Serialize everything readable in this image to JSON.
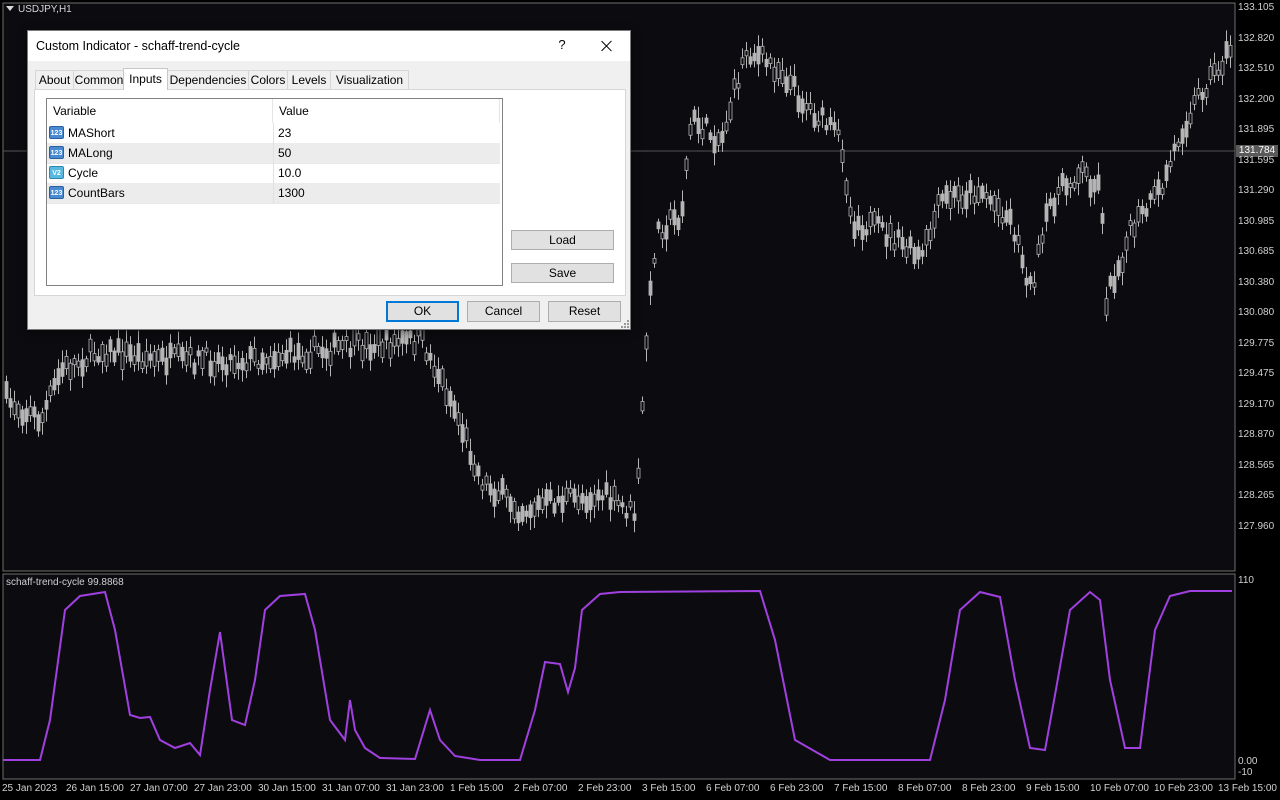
{
  "chart": {
    "symbol": "USDJPY,H1",
    "current_price": "131.784",
    "price_ticks": [
      "133.105",
      "132.820",
      "132.510",
      "132.200",
      "131.895",
      "131.595",
      "131.290",
      "130.985",
      "130.685",
      "130.380",
      "130.080",
      "129.775",
      "129.475",
      "129.170",
      "128.870",
      "128.565",
      "128.265",
      "127.960"
    ],
    "time_ticks": [
      "25 Jan 2023",
      "26 Jan 15:00",
      "27 Jan 07:00",
      "27 Jan 23:00",
      "30 Jan 15:00",
      "31 Jan 07:00",
      "31 Jan 23:00",
      "1 Feb 15:00",
      "2 Feb 07:00",
      "2 Feb 23:00",
      "3 Feb 15:00",
      "6 Feb 07:00",
      "6 Feb 23:00",
      "7 Feb 15:00",
      "8 Feb 07:00",
      "8 Feb 23:00",
      "9 Feb 15:00",
      "10 Feb 07:00",
      "10 Feb 23:00",
      "13 Feb 15:00"
    ],
    "candle_color": "#b5b5b5"
  },
  "indicator": {
    "title": "schaff-trend-cycle 99.8868",
    "line_color": "#a040e0",
    "scale_ticks": [
      "110",
      "0.00",
      "-10"
    ]
  },
  "dialog": {
    "title": "Custom Indicator - schaff-trend-cycle",
    "help_label": "?",
    "tabs": [
      "About",
      "Common",
      "Inputs",
      "Dependencies",
      "Colors",
      "Levels",
      "Visualization"
    ],
    "active_tab": "Inputs",
    "columns": {
      "variable": "Variable",
      "value": "Value"
    },
    "params": [
      {
        "type_icon": "123",
        "kind": "int",
        "name": "MAShort",
        "value": "23"
      },
      {
        "type_icon": "123",
        "kind": "int",
        "name": "MALong",
        "value": "50"
      },
      {
        "type_icon": "V2",
        "kind": "dbl",
        "name": "Cycle",
        "value": "10.0"
      },
      {
        "type_icon": "123",
        "kind": "int",
        "name": "CountBars",
        "value": "1300"
      }
    ],
    "buttons": {
      "load": "Load",
      "save": "Save",
      "ok": "OK",
      "cancel": "Cancel",
      "reset": "Reset"
    }
  }
}
